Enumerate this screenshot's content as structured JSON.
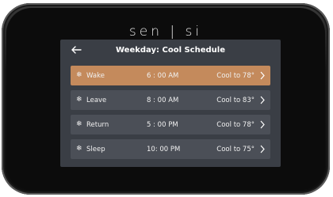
{
  "brand": {
    "name": "sen | si"
  },
  "header": {
    "title": "Weekday: Cool Schedule",
    "back_icon": "left-arrow-icon"
  },
  "schedule": [
    {
      "period": "Wake",
      "time": "6 : 00 AM",
      "setting": "Cool to 78°",
      "selected": true
    },
    {
      "period": "Leave",
      "time": "8 : 00 AM",
      "setting": "Cool to 83°",
      "selected": false
    },
    {
      "period": "Return",
      "time": "5 : 00 PM",
      "setting": "Cool to 78°",
      "selected": false
    },
    {
      "period": "Sleep",
      "time": "10: 00 PM",
      "setting": "Cool to 75°",
      "selected": false
    }
  ],
  "icons": {
    "mode": "snowflake-icon",
    "row_action": "chevron-right-icon"
  },
  "colors": {
    "selected_row": "#c48a5c",
    "row": "#4b4f57",
    "screen": "#3a3e45"
  }
}
